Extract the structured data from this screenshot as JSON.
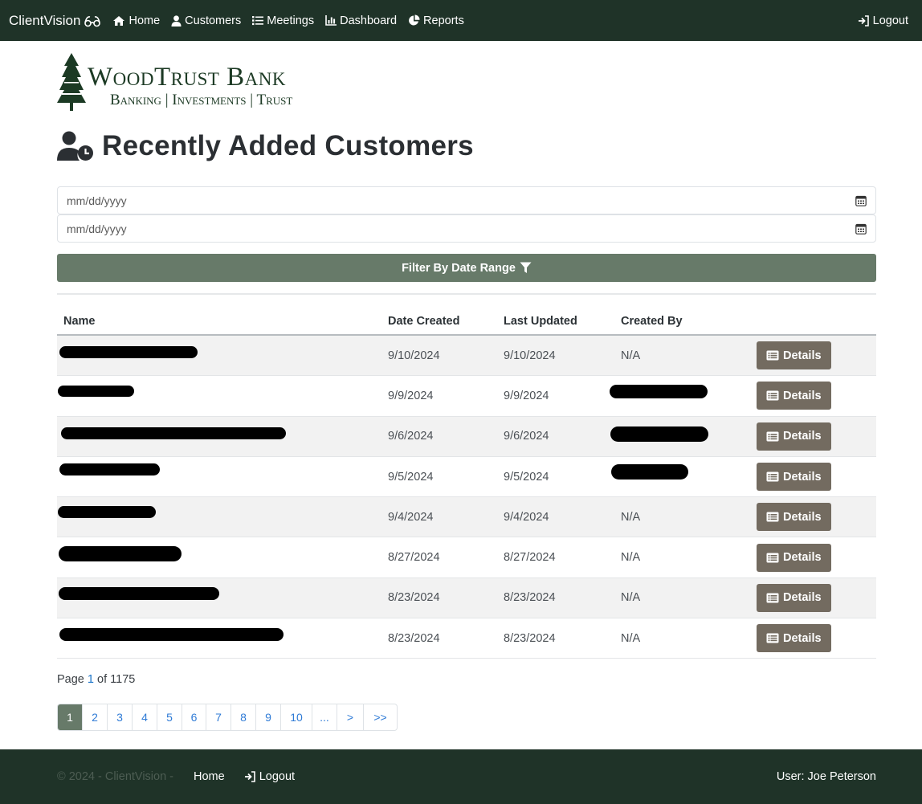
{
  "nav": {
    "brand": "ClientVision",
    "items": [
      {
        "label": "Home",
        "icon": "home-icon"
      },
      {
        "label": "Customers",
        "icon": "user-icon"
      },
      {
        "label": "Meetings",
        "icon": "list-icon"
      },
      {
        "label": "Dashboard",
        "icon": "chart-icon"
      },
      {
        "label": "Reports",
        "icon": "pie-icon"
      }
    ],
    "logout": "Logout"
  },
  "logo": {
    "name": "WoodTrust Bank",
    "tagline": "Banking | Investments | Trust"
  },
  "page": {
    "title": "Recently Added Customers"
  },
  "filters": {
    "start_placeholder": "mm/dd/yyyy",
    "end_placeholder": "mm/dd/yyyy",
    "button_label": "Filter By Date Range"
  },
  "table": {
    "headers": {
      "name": "Name",
      "created": "Date Created",
      "updated": "Last Updated",
      "created_by": "Created By"
    },
    "action_label": "Details",
    "rows": [
      {
        "name": "",
        "created": "9/10/2024",
        "updated": "9/10/2024",
        "created_by": "N/A"
      },
      {
        "name": "",
        "created": "9/9/2024",
        "updated": "9/9/2024",
        "created_by": ""
      },
      {
        "name": "",
        "created": "9/6/2024",
        "updated": "9/6/2024",
        "created_by": ""
      },
      {
        "name": "",
        "created": "9/5/2024",
        "updated": "9/5/2024",
        "created_by": ""
      },
      {
        "name": "",
        "created": "9/4/2024",
        "updated": "9/4/2024",
        "created_by": "N/A"
      },
      {
        "name": "",
        "created": "8/27/2024",
        "updated": "8/27/2024",
        "created_by": "N/A"
      },
      {
        "name": "",
        "created": "8/23/2024",
        "updated": "8/23/2024",
        "created_by": "N/A"
      },
      {
        "name": "",
        "created": "8/23/2024",
        "updated": "8/23/2024",
        "created_by": "N/A"
      }
    ]
  },
  "pagination": {
    "prefix": "Page",
    "current": "1",
    "of_label": "of",
    "total": "1175",
    "pages": [
      "1",
      "2",
      "3",
      "4",
      "5",
      "6",
      "7",
      "8",
      "9",
      "10",
      "...",
      ">",
      ">>"
    ]
  },
  "footer": {
    "copyright": "© 2024 - ClientVision -",
    "home": "Home",
    "logout": "Logout",
    "user": "User: Joe Peterson"
  }
}
